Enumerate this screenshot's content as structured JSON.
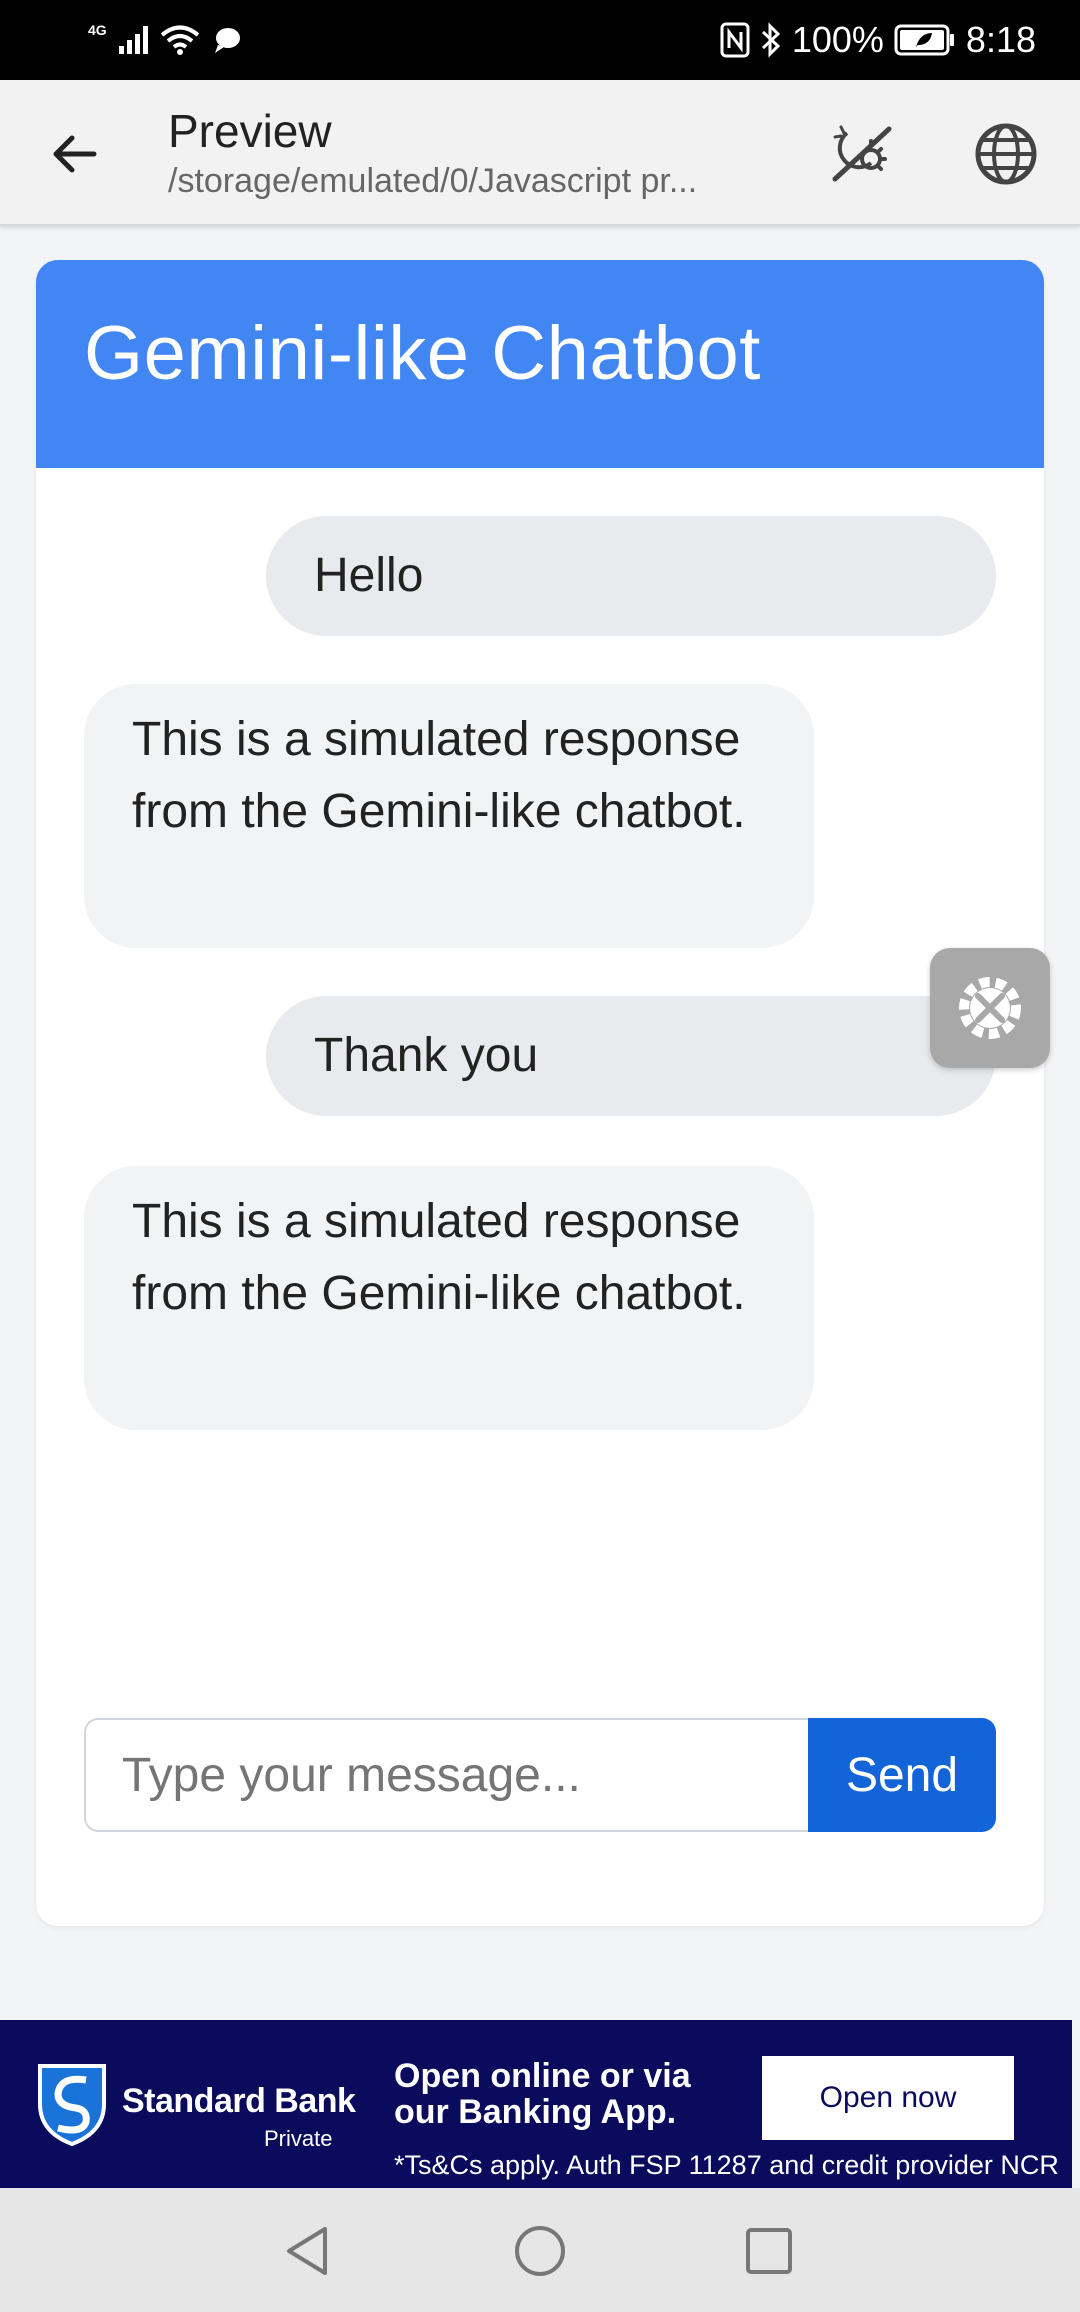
{
  "status_bar": {
    "network": "4G",
    "battery": "100%",
    "time": "8:18"
  },
  "app_bar": {
    "title": "Preview",
    "subtitle": "/storage/emulated/0/Javascript pr..."
  },
  "chat": {
    "header_title": "Gemini-like Chatbot",
    "messages": [
      {
        "role": "user",
        "text": "Hello"
      },
      {
        "role": "bot",
        "text": "This is a simulated response from the Gemini-like chatbot."
      },
      {
        "role": "user",
        "text": "Thank you"
      },
      {
        "role": "bot",
        "text": "This is a simulated response from the Gemini-like chatbot."
      }
    ],
    "input_placeholder": "Type your message...",
    "send_label": "Send"
  },
  "ad": {
    "brand": "Standard Bank",
    "brand_sub": "Private",
    "headline_line1": "Open online or via",
    "headline_line2": "our Banking App.",
    "cta": "Open now",
    "fine_print": "*Ts&Cs apply. Auth FSP 11287 and credit provider NCR"
  },
  "colors": {
    "header_blue": "#4286f4",
    "send_blue": "#1264d8",
    "ad_navy": "#0a0b5c"
  }
}
